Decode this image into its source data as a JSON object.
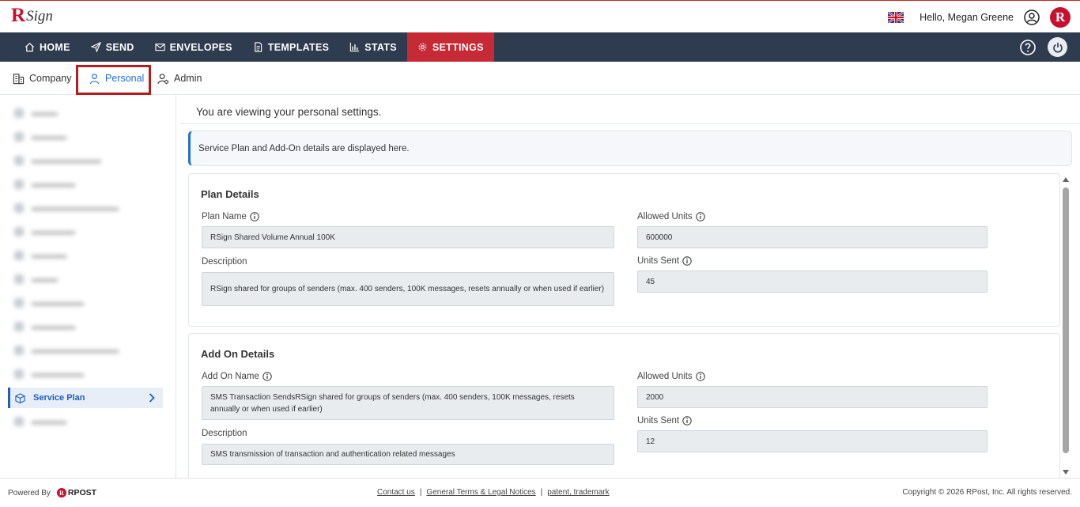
{
  "header": {
    "logo_r": "R",
    "logo_text": "Sign",
    "greeting": "Hello, Megan Greene",
    "brand_badge": "R",
    "flag": "uk-flag-icon"
  },
  "nav": {
    "items": [
      {
        "label": "HOME",
        "icon": "home-icon"
      },
      {
        "label": "SEND",
        "icon": "send-icon"
      },
      {
        "label": "ENVELOPES",
        "icon": "envelope-icon"
      },
      {
        "label": "TEMPLATES",
        "icon": "document-icon"
      },
      {
        "label": "STATS",
        "icon": "bar-chart-icon"
      },
      {
        "label": "SETTINGS",
        "icon": "gear-icon",
        "active": true
      }
    ],
    "accent_color": "#c62a35",
    "bar_color": "#2f3b4e"
  },
  "subtabs": {
    "company": "Company",
    "personal": "Personal",
    "admin": "Admin",
    "active": "Personal"
  },
  "sidebar": {
    "active_item": "Service Plan"
  },
  "main": {
    "viewing_text": "You are viewing your personal settings.",
    "info_banner": "Service Plan and Add-On details are displayed here.",
    "plan": {
      "title": "Plan Details",
      "plan_name_label": "Plan Name",
      "plan_name_value": "RSign Shared Volume Annual 100K",
      "description_label": "Description",
      "description_value": "RSign shared for groups of senders (max. 400 senders, 100K messages, resets annually or when used if earlier)",
      "allowed_units_label": "Allowed Units",
      "allowed_units_value": "600000",
      "units_sent_label": "Units Sent",
      "units_sent_value": "45"
    },
    "addon": {
      "title": "Add On Details",
      "addon_name_label": "Add On Name",
      "addon_name_value": "SMS Transaction SendsRSign shared for groups of senders (max. 400 senders, 100K messages, resets annually or when used if earlier)",
      "description_label": "Description",
      "description_value": "SMS transmission of transaction and authentication related messages",
      "allowed_units_label": "Allowed Units",
      "allowed_units_value": "2000",
      "units_sent_label": "Units Sent",
      "units_sent_value": "12"
    }
  },
  "footer": {
    "powered_by": "Powered By",
    "rpost_badge": "R",
    "rpost_text": "RPOST",
    "links": [
      "Contact us",
      "General Terms & Legal Notices",
      "patent, trademark"
    ],
    "separator": "|",
    "copyright": "Copyright © 2026 RPost, Inc. All rights reserved."
  }
}
